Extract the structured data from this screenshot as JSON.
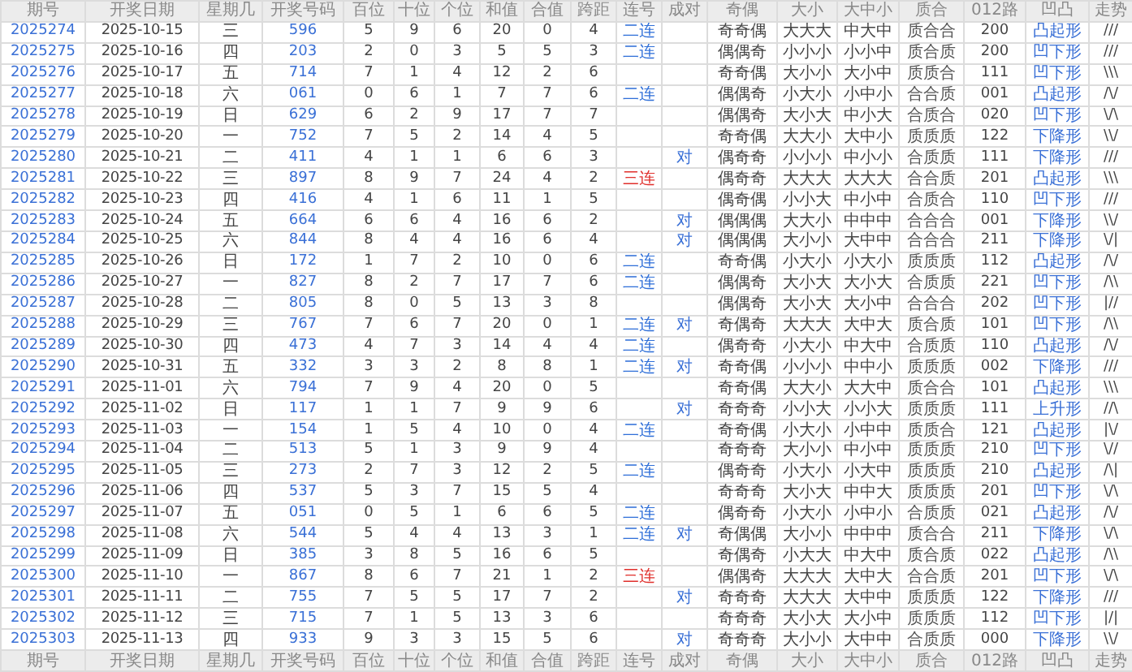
{
  "header_top": [
    "期号",
    "开奖日期",
    "星期几",
    "开奖号码",
    "百位",
    "十位",
    "个位",
    "和值",
    "合值",
    "跨距",
    "连号",
    "成对",
    "奇偶",
    "大小",
    "大中小",
    "质合",
    "012路",
    "凹凸",
    "走势"
  ],
  "rows": [
    {
      "issue": "2025274",
      "date": "2025-10-15",
      "weekday": "三",
      "number": "596",
      "hundreds": "5",
      "tens": "9",
      "units": "6",
      "sum": "20",
      "sum_tail": "0",
      "span": "4",
      "streak": {
        "text": "二连",
        "color": "#2f6fd8"
      },
      "odd_even": "奇奇偶",
      "big_small": "大大大",
      "big_mid_small": "中大中",
      "prime_composite": "质合合",
      "route_012": "200",
      "shape": "凸起形",
      "trend": "///"
    },
    {
      "issue": "2025275",
      "date": "2025-10-16",
      "weekday": "四",
      "number": "203",
      "hundreds": "2",
      "tens": "0",
      "units": "3",
      "sum": "5",
      "sum_tail": "5",
      "span": "3",
      "streak": {
        "text": "二连",
        "color": "#2f6fd8"
      },
      "odd_even": "偶偶奇",
      "big_small": "小小小",
      "big_mid_small": "小小中",
      "prime_composite": "质合质",
      "route_012": "200",
      "shape": "凹下形",
      "trend": "///"
    },
    {
      "issue": "2025276",
      "date": "2025-10-17",
      "weekday": "五",
      "number": "714",
      "hundreds": "7",
      "tens": "1",
      "units": "4",
      "sum": "12",
      "sum_tail": "2",
      "span": "6",
      "odd_even": "奇奇偶",
      "big_small": "大小小",
      "big_mid_small": "大小中",
      "prime_composite": "质质合",
      "route_012": "111",
      "shape": "凹下形",
      "trend": "\\\\\\"
    },
    {
      "issue": "2025277",
      "date": "2025-10-18",
      "weekday": "六",
      "number": "061",
      "hundreds": "0",
      "tens": "6",
      "units": "1",
      "sum": "7",
      "sum_tail": "7",
      "span": "6",
      "streak": {
        "text": "二连",
        "color": "#2f6fd8"
      },
      "odd_even": "偶偶奇",
      "big_small": "小大小",
      "big_mid_small": "小中小",
      "prime_composite": "合合质",
      "route_012": "001",
      "shape": "凸起形",
      "trend": "/\\/"
    },
    {
      "issue": "2025278",
      "date": "2025-10-19",
      "weekday": "日",
      "number": "629",
      "hundreds": "6",
      "tens": "2",
      "units": "9",
      "sum": "17",
      "sum_tail": "7",
      "span": "7",
      "odd_even": "偶偶奇",
      "big_small": "大小大",
      "big_mid_small": "中小大",
      "prime_composite": "合质合",
      "route_012": "020",
      "shape": "凹下形",
      "trend": "\\/\\"
    },
    {
      "issue": "2025279",
      "date": "2025-10-20",
      "weekday": "一",
      "number": "752",
      "hundreds": "7",
      "tens": "5",
      "units": "2",
      "sum": "14",
      "sum_tail": "4",
      "span": "5",
      "odd_even": "奇奇偶",
      "big_small": "大大小",
      "big_mid_small": "大中小",
      "prime_composite": "质质质",
      "route_012": "122",
      "shape": "下降形",
      "trend": "\\\\/"
    },
    {
      "issue": "2025280",
      "date": "2025-10-21",
      "weekday": "二",
      "number": "411",
      "hundreds": "4",
      "tens": "1",
      "units": "1",
      "sum": "6",
      "sum_tail": "6",
      "span": "3",
      "pair": "对",
      "odd_even": "偶奇奇",
      "big_small": "小小小",
      "big_mid_small": "中小小",
      "prime_composite": "合质质",
      "route_012": "111",
      "shape": "下降形",
      "trend": "///"
    },
    {
      "issue": "2025281",
      "date": "2025-10-22",
      "weekday": "三",
      "number": "897",
      "hundreds": "8",
      "tens": "9",
      "units": "7",
      "sum": "24",
      "sum_tail": "4",
      "span": "2",
      "streak": {
        "text": "三连",
        "color": "#e0302c"
      },
      "odd_even": "偶奇奇",
      "big_small": "大大大",
      "big_mid_small": "大大大",
      "prime_composite": "合合质",
      "route_012": "201",
      "shape": "凸起形",
      "trend": "\\\\\\"
    },
    {
      "issue": "2025282",
      "date": "2025-10-23",
      "weekday": "四",
      "number": "416",
      "hundreds": "4",
      "tens": "1",
      "units": "6",
      "sum": "11",
      "sum_tail": "1",
      "span": "5",
      "odd_even": "偶奇偶",
      "big_small": "小小大",
      "big_mid_small": "中小中",
      "prime_composite": "合质合",
      "route_012": "110",
      "shape": "凹下形",
      "trend": "///"
    },
    {
      "issue": "2025283",
      "date": "2025-10-24",
      "weekday": "五",
      "number": "664",
      "hundreds": "6",
      "tens": "6",
      "units": "4",
      "sum": "16",
      "sum_tail": "6",
      "span": "2",
      "pair": "对",
      "odd_even": "偶偶偶",
      "big_small": "大大小",
      "big_mid_small": "中中中",
      "prime_composite": "合合合",
      "route_012": "001",
      "shape": "下降形",
      "trend": "\\\\/"
    },
    {
      "issue": "2025284",
      "date": "2025-10-25",
      "weekday": "六",
      "number": "844",
      "hundreds": "8",
      "tens": "4",
      "units": "4",
      "sum": "16",
      "sum_tail": "6",
      "span": "4",
      "pair": "对",
      "odd_even": "偶偶偶",
      "big_small": "大小小",
      "big_mid_small": "大中中",
      "prime_composite": "合合合",
      "route_012": "211",
      "shape": "下降形",
      "trend": "\\/|"
    },
    {
      "issue": "2025285",
      "date": "2025-10-26",
      "weekday": "日",
      "number": "172",
      "hundreds": "1",
      "tens": "7",
      "units": "2",
      "sum": "10",
      "sum_tail": "0",
      "span": "6",
      "streak": {
        "text": "二连",
        "color": "#2f6fd8"
      },
      "odd_even": "奇奇偶",
      "big_small": "小大小",
      "big_mid_small": "小大小",
      "prime_composite": "质质质",
      "route_012": "112",
      "shape": "凸起形",
      "trend": "/\\/"
    },
    {
      "issue": "2025286",
      "date": "2025-10-27",
      "weekday": "一",
      "number": "827",
      "hundreds": "8",
      "tens": "2",
      "units": "7",
      "sum": "17",
      "sum_tail": "7",
      "span": "6",
      "streak": {
        "text": "二连",
        "color": "#2f6fd8"
      },
      "odd_even": "偶偶奇",
      "big_small": "大小大",
      "big_mid_small": "大小大",
      "prime_composite": "合质质",
      "route_012": "221",
      "shape": "凹下形",
      "trend": "/\\\\"
    },
    {
      "issue": "2025287",
      "date": "2025-10-28",
      "weekday": "二",
      "number": "805",
      "hundreds": "8",
      "tens": "0",
      "units": "5",
      "sum": "13",
      "sum_tail": "3",
      "span": "8",
      "odd_even": "偶偶奇",
      "big_small": "大小大",
      "big_mid_small": "大小中",
      "prime_composite": "合合合",
      "route_012": "202",
      "shape": "凹下形",
      "trend": "|//"
    },
    {
      "issue": "2025288",
      "date": "2025-10-29",
      "weekday": "三",
      "number": "767",
      "hundreds": "7",
      "tens": "6",
      "units": "7",
      "sum": "20",
      "sum_tail": "0",
      "span": "1",
      "streak": {
        "text": "二连",
        "color": "#2f6fd8"
      },
      "pair": "对",
      "odd_even": "奇偶奇",
      "big_small": "大大大",
      "big_mid_small": "大中大",
      "prime_composite": "质合质",
      "route_012": "101",
      "shape": "凹下形",
      "trend": "/\\\\"
    },
    {
      "issue": "2025289",
      "date": "2025-10-30",
      "weekday": "四",
      "number": "473",
      "hundreds": "4",
      "tens": "7",
      "units": "3",
      "sum": "14",
      "sum_tail": "4",
      "span": "4",
      "streak": {
        "text": "二连",
        "color": "#2f6fd8"
      },
      "odd_even": "偶奇奇",
      "big_small": "小大小",
      "big_mid_small": "中大中",
      "prime_composite": "合质质",
      "route_012": "110",
      "shape": "凸起形",
      "trend": "/\\/"
    },
    {
      "issue": "2025290",
      "date": "2025-10-31",
      "weekday": "五",
      "number": "332",
      "hundreds": "3",
      "tens": "3",
      "units": "2",
      "sum": "8",
      "sum_tail": "8",
      "span": "1",
      "streak": {
        "text": "二连",
        "color": "#2f6fd8"
      },
      "pair": "对",
      "odd_even": "奇奇偶",
      "big_small": "小小小",
      "big_mid_small": "中中小",
      "prime_composite": "质质质",
      "route_012": "002",
      "shape": "下降形",
      "trend": "///"
    },
    {
      "issue": "2025291",
      "date": "2025-11-01",
      "weekday": "六",
      "number": "794",
      "hundreds": "7",
      "tens": "9",
      "units": "4",
      "sum": "20",
      "sum_tail": "0",
      "span": "5",
      "odd_even": "奇奇偶",
      "big_small": "大大小",
      "big_mid_small": "大大中",
      "prime_composite": "质合合",
      "route_012": "101",
      "shape": "凸起形",
      "trend": "\\\\\\"
    },
    {
      "issue": "2025292",
      "date": "2025-11-02",
      "weekday": "日",
      "number": "117",
      "hundreds": "1",
      "tens": "1",
      "units": "7",
      "sum": "9",
      "sum_tail": "9",
      "span": "6",
      "pair": "对",
      "odd_even": "奇奇奇",
      "big_small": "小小大",
      "big_mid_small": "小小大",
      "prime_composite": "质质质",
      "route_012": "111",
      "shape": "上升形",
      "trend": "//\\"
    },
    {
      "issue": "2025293",
      "date": "2025-11-03",
      "weekday": "一",
      "number": "154",
      "hundreds": "1",
      "tens": "5",
      "units": "4",
      "sum": "10",
      "sum_tail": "0",
      "span": "4",
      "streak": {
        "text": "二连",
        "color": "#2f6fd8"
      },
      "odd_even": "奇奇偶",
      "big_small": "小大小",
      "big_mid_small": "小中中",
      "prime_composite": "质质合",
      "route_012": "121",
      "shape": "凸起形",
      "trend": "|\\/"
    },
    {
      "issue": "2025294",
      "date": "2025-11-04",
      "weekday": "二",
      "number": "513",
      "hundreds": "5",
      "tens": "1",
      "units": "3",
      "sum": "9",
      "sum_tail": "9",
      "span": "4",
      "odd_even": "奇奇奇",
      "big_small": "大小小",
      "big_mid_small": "中小中",
      "prime_composite": "质质质",
      "route_012": "210",
      "shape": "凹下形",
      "trend": "\\//"
    },
    {
      "issue": "2025295",
      "date": "2025-11-05",
      "weekday": "三",
      "number": "273",
      "hundreds": "2",
      "tens": "7",
      "units": "3",
      "sum": "12",
      "sum_tail": "2",
      "span": "5",
      "streak": {
        "text": "二连",
        "color": "#2f6fd8"
      },
      "odd_even": "偶奇奇",
      "big_small": "小大小",
      "big_mid_small": "小大中",
      "prime_composite": "质质质",
      "route_012": "210",
      "shape": "凸起形",
      "trend": "/\\|"
    },
    {
      "issue": "2025296",
      "date": "2025-11-06",
      "weekday": "四",
      "number": "537",
      "hundreds": "5",
      "tens": "3",
      "units": "7",
      "sum": "15",
      "sum_tail": "5",
      "span": "4",
      "odd_even": "奇奇奇",
      "big_small": "大小大",
      "big_mid_small": "中中大",
      "prime_composite": "质质质",
      "route_012": "201",
      "shape": "凹下形",
      "trend": "\\/\\"
    },
    {
      "issue": "2025297",
      "date": "2025-11-07",
      "weekday": "五",
      "number": "051",
      "hundreds": "0",
      "tens": "5",
      "units": "1",
      "sum": "6",
      "sum_tail": "6",
      "span": "5",
      "streak": {
        "text": "二连",
        "color": "#2f6fd8"
      },
      "odd_even": "偶奇奇",
      "big_small": "小大小",
      "big_mid_small": "小中小",
      "prime_composite": "合质质",
      "route_012": "021",
      "shape": "凸起形",
      "trend": "/\\/"
    },
    {
      "issue": "2025298",
      "date": "2025-11-08",
      "weekday": "六",
      "number": "544",
      "hundreds": "5",
      "tens": "4",
      "units": "4",
      "sum": "13",
      "sum_tail": "3",
      "span": "1",
      "streak": {
        "text": "二连",
        "color": "#2f6fd8"
      },
      "pair": "对",
      "odd_even": "奇偶偶",
      "big_small": "大小小",
      "big_mid_small": "中中中",
      "prime_composite": "质合合",
      "route_012": "211",
      "shape": "下降形",
      "trend": "\\/\\"
    },
    {
      "issue": "2025299",
      "date": "2025-11-09",
      "weekday": "日",
      "number": "385",
      "hundreds": "3",
      "tens": "8",
      "units": "5",
      "sum": "16",
      "sum_tail": "6",
      "span": "5",
      "odd_even": "奇偶奇",
      "big_small": "小大大",
      "big_mid_small": "中大中",
      "prime_composite": "质合质",
      "route_012": "022",
      "shape": "凸起形",
      "trend": "/\\\\"
    },
    {
      "issue": "2025300",
      "date": "2025-11-10",
      "weekday": "一",
      "number": "867",
      "hundreds": "8",
      "tens": "6",
      "units": "7",
      "sum": "21",
      "sum_tail": "1",
      "span": "2",
      "streak": {
        "text": "三连",
        "color": "#e0302c"
      },
      "odd_even": "偶偶奇",
      "big_small": "大大大",
      "big_mid_small": "大中大",
      "prime_composite": "合合质",
      "route_012": "201",
      "shape": "凹下形",
      "trend": "\\/\\"
    },
    {
      "issue": "2025301",
      "date": "2025-11-11",
      "weekday": "二",
      "number": "755",
      "hundreds": "7",
      "tens": "5",
      "units": "5",
      "sum": "17",
      "sum_tail": "7",
      "span": "2",
      "pair": "对",
      "odd_even": "奇奇奇",
      "big_small": "大大大",
      "big_mid_small": "大中中",
      "prime_composite": "质质质",
      "route_012": "122",
      "shape": "下降形",
      "trend": "///"
    },
    {
      "issue": "2025302",
      "date": "2025-11-12",
      "weekday": "三",
      "number": "715",
      "hundreds": "7",
      "tens": "1",
      "units": "5",
      "sum": "13",
      "sum_tail": "3",
      "span": "6",
      "odd_even": "奇奇奇",
      "big_small": "大小大",
      "big_mid_small": "大小中",
      "prime_composite": "质质质",
      "route_012": "112",
      "shape": "凹下形",
      "trend": "|/|"
    },
    {
      "issue": "2025303",
      "date": "2025-11-13",
      "weekday": "四",
      "number": "933",
      "hundreds": "9",
      "tens": "3",
      "units": "3",
      "sum": "15",
      "sum_tail": "5",
      "span": "6",
      "pair": "对",
      "odd_even": "奇奇奇",
      "big_small": "大小小",
      "big_mid_small": "大中中",
      "prime_composite": "合质质",
      "route_012": "000",
      "shape": "下降形",
      "trend": "\\\\/"
    }
  ],
  "header_bottom": [
    "期号",
    "开奖日期",
    "星期几",
    "开奖号码",
    "百位",
    "十位",
    "个位",
    "和值",
    "合值",
    "跨距",
    "连号",
    "成对",
    "奇偶",
    "大小",
    "大中小",
    "质合",
    "012路",
    "凹凸",
    "走势"
  ]
}
